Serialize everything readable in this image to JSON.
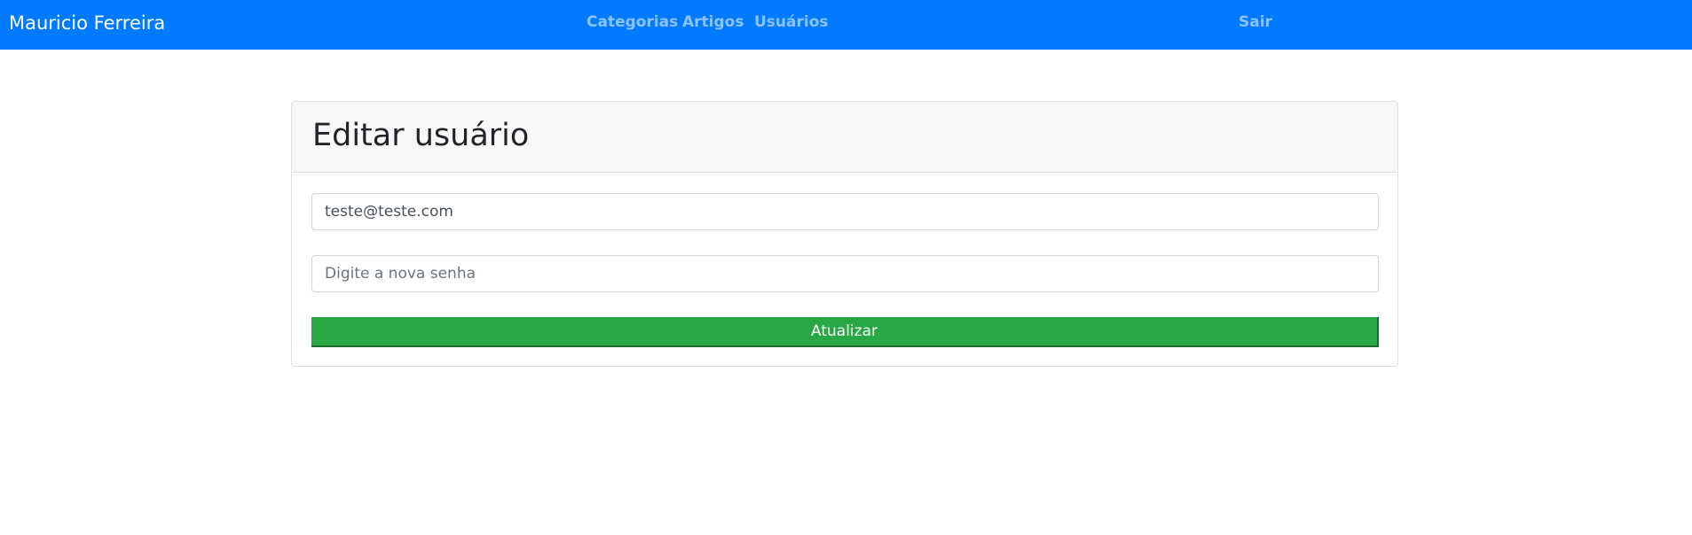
{
  "navbar": {
    "brand": "Mauricio Ferreira",
    "links": [
      {
        "label": "Categorias"
      },
      {
        "label": "Artigos"
      },
      {
        "label": "Usuários"
      }
    ],
    "logout_label": "Sair",
    "background_color": "#007bff"
  },
  "form": {
    "title": "Editar usuário",
    "email_value": "teste@teste.com",
    "password_placeholder": "Digite a nova senha",
    "submit_label": "Atualizar",
    "submit_color": "#28a745"
  }
}
